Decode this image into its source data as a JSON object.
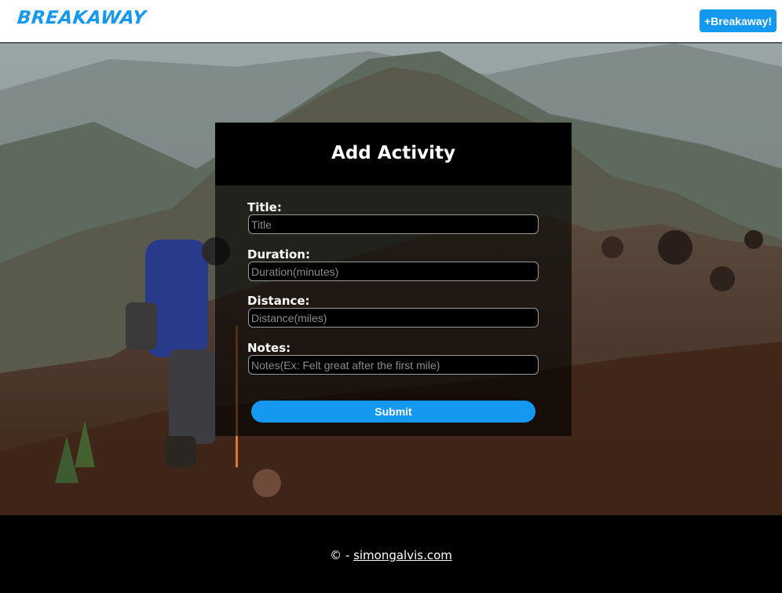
{
  "navbar": {
    "logo_text": "BREAKAWAY",
    "action_button_label": "+Breakaway!"
  },
  "form": {
    "title": "Add Activity",
    "fields": [
      {
        "label": "Title:",
        "placeholder": "Title",
        "value": ""
      },
      {
        "label": "Duration:",
        "placeholder": "Duration(minutes)",
        "value": ""
      },
      {
        "label": "Distance:",
        "placeholder": "Distance(miles)",
        "value": ""
      },
      {
        "label": "Notes:",
        "placeholder": "Notes(Ex: Felt great after the first mile)",
        "value": ""
      }
    ],
    "submit_label": "Submit"
  },
  "footer": {
    "prefix": "© - ",
    "link_text": "simongalvis.com"
  },
  "colors": {
    "accent": "#1598f0",
    "navbar_bg": "#ffffff",
    "footer_bg": "#000000",
    "card_header_bg": "#000000"
  },
  "icons": {
    "hero": "hiker-mountain-background-image"
  }
}
